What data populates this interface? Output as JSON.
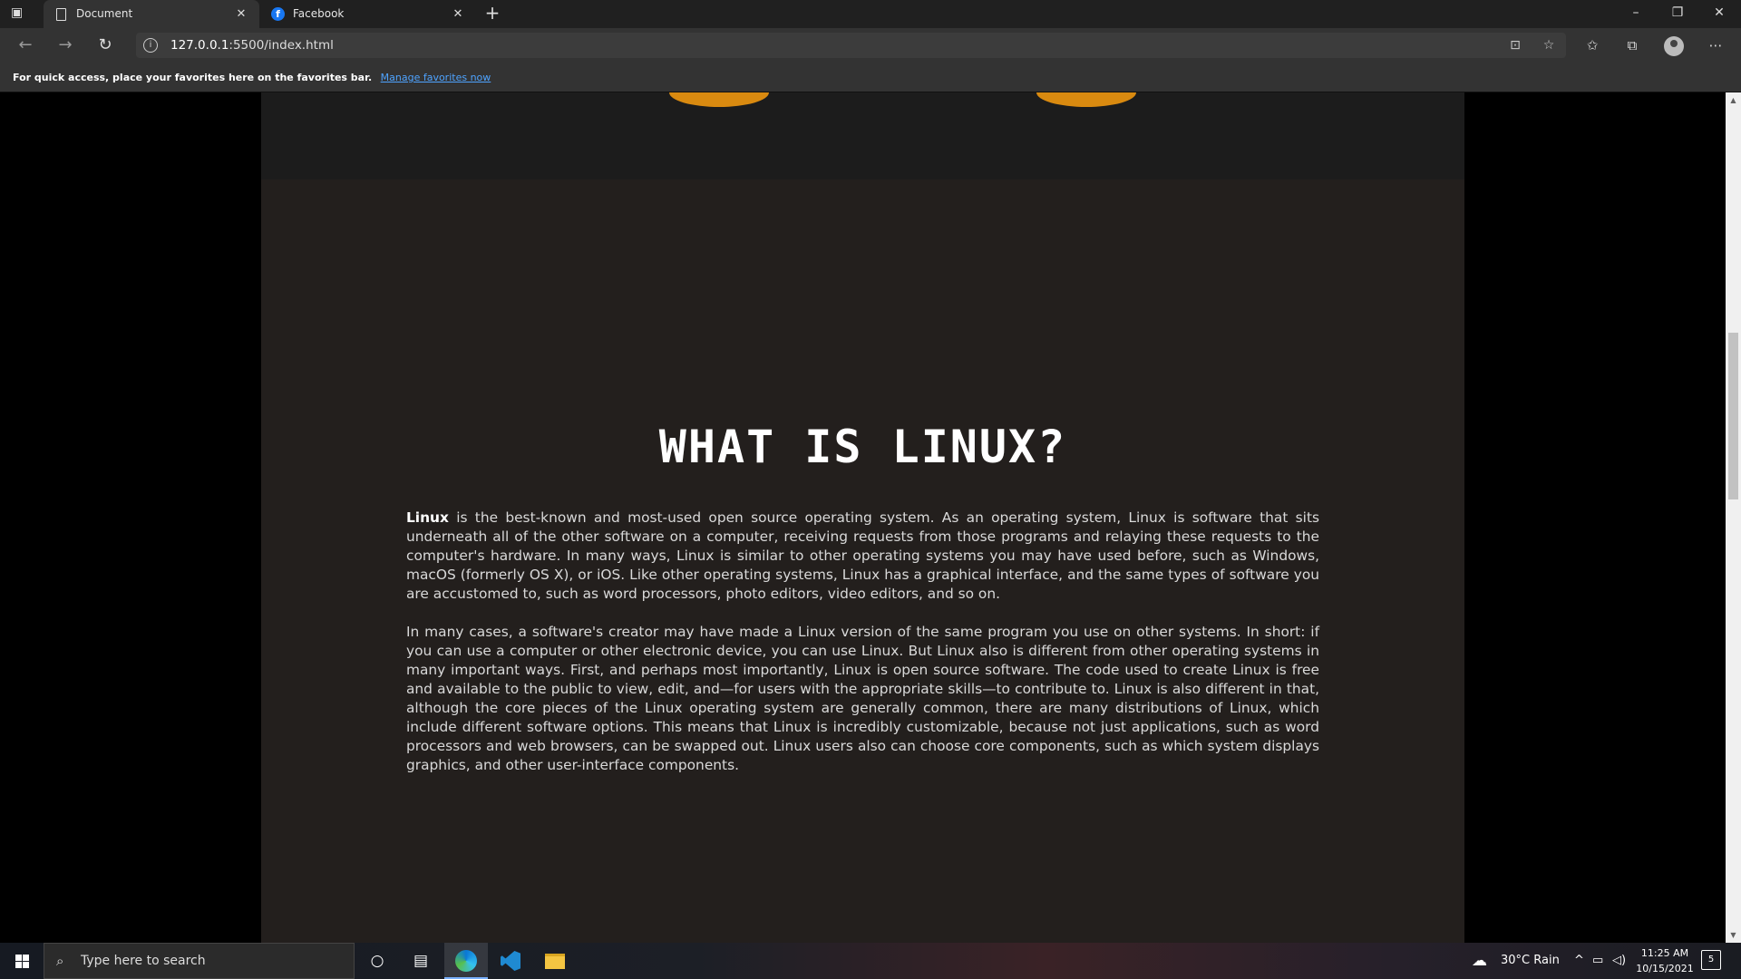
{
  "browser": {
    "tabs": [
      {
        "label": "Document",
        "icon": "document-icon",
        "active": true
      },
      {
        "label": "Facebook",
        "icon": "facebook-icon",
        "active": false
      }
    ],
    "new_tab_glyph": "+",
    "url_host": "127.0.0.1",
    "url_rest": ":5500/index.html",
    "favorites_bar": {
      "text": "For quick access, place your favorites here on the favorites bar.",
      "link": "Manage favorites now"
    }
  },
  "page": {
    "heading": "WHAT IS LINUX?",
    "paragraph1_lead": "Linux",
    "paragraph1": " is the best-known and most-used open source operating system. As an operating system, Linux is software that sits underneath all of the other software on a computer, receiving requests from those programs and relaying these requests to the computer's hardware. In many ways, Linux is similar to other operating systems you may have used before, such as Windows, macOS (formerly OS X), or iOS. Like other operating systems, Linux has a graphical interface, and the same types of software you are accustomed to, such as word processors, photo editors, video editors, and so on.",
    "paragraph2": "In many cases, a software's creator may have made a Linux version of the same program you use on other systems. In short: if you can use a computer or other electronic device, you can use Linux. But Linux also is different from other operating systems in many important ways. First, and perhaps most importantly, Linux is open source software. The code used to create Linux is free and available to the public to view, edit, and—for users with the appropriate skills—to contribute to. Linux is also different in that, although the core pieces of the Linux operating system are generally common, there are many distributions of Linux, which include different software options. This means that Linux is incredibly customizable, because not just applications, such as word processors and web browsers, can be swapped out. Linux users also can choose core components, such as which system displays graphics, and other user-interface components."
  },
  "taskbar": {
    "search_placeholder": "Type here to search",
    "weather": "30°C  Rain",
    "time": "11:25 AM",
    "date": "10/15/2021",
    "notification_count": "5"
  },
  "colors": {
    "accent_link": "#4ea3ff",
    "page_bg": "#231f1d",
    "hero_orange": "#d98a10"
  }
}
